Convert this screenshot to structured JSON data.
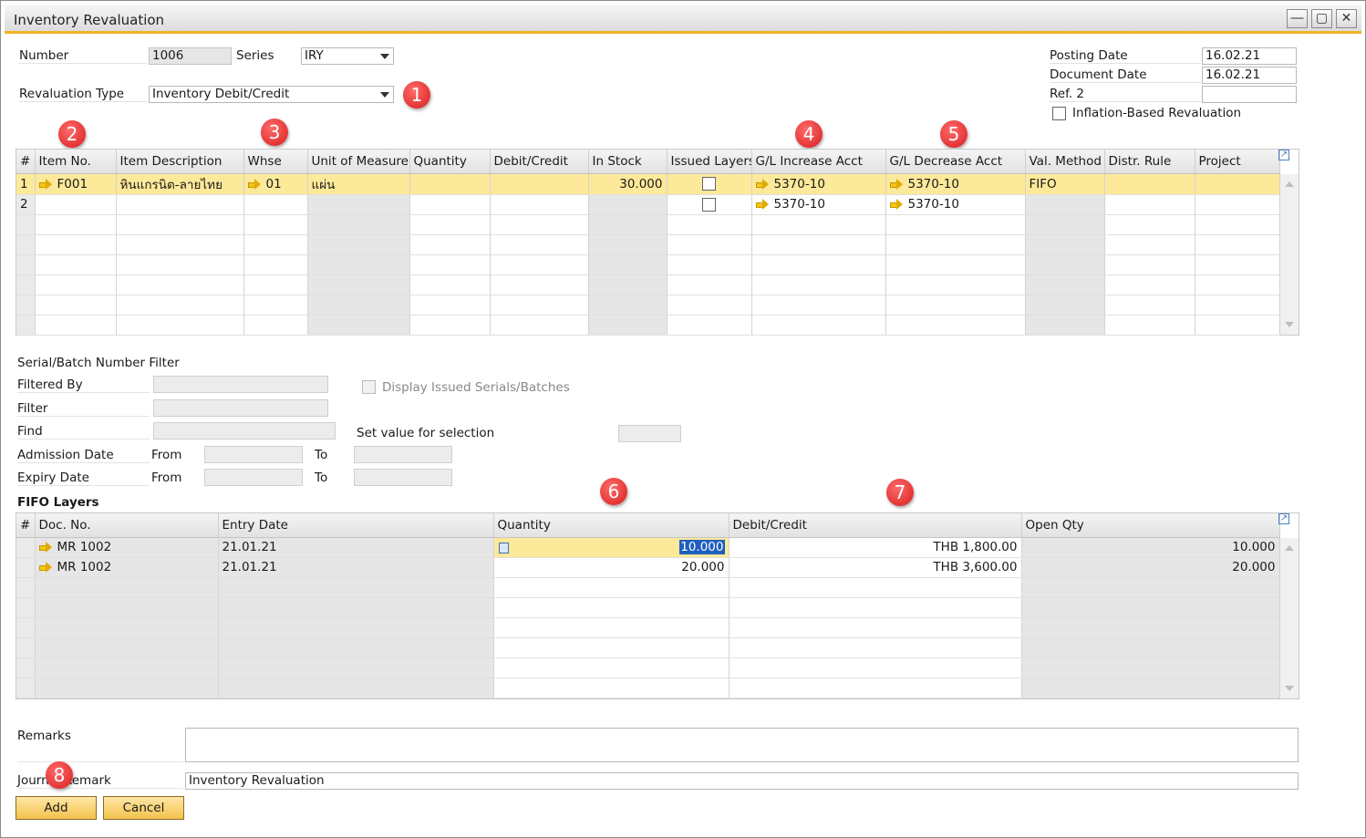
{
  "window": {
    "title": "Inventory Revaluation"
  },
  "header": {
    "number_label": "Number",
    "number_value": "1006",
    "series_label": "Series",
    "series_value": "IRY",
    "reval_type_label": "Revaluation Type",
    "reval_type_value": "Inventory Debit/Credit",
    "posting_date_label": "Posting Date",
    "posting_date_value": "16.02.21",
    "document_date_label": "Document Date",
    "document_date_value": "16.02.21",
    "ref2_label": "Ref. 2",
    "ref2_value": "",
    "inflation_label": "Inflation-Based Revaluation"
  },
  "badges": [
    "1",
    "2",
    "3",
    "4",
    "5",
    "6",
    "7",
    "8"
  ],
  "items_grid": {
    "columns": [
      "#",
      "Item No.",
      "Item Description",
      "Whse",
      "Unit of Measure",
      "Quantity",
      "Debit/Credit",
      "In Stock",
      "Issued Layers",
      "G/L Increase Acct",
      "G/L Decrease Acct",
      "Val. Method",
      "Distr. Rule",
      "Project"
    ],
    "rows": [
      {
        "num": "1",
        "item_no": "F001",
        "desc": "หินแกรนิต-ลายไทย",
        "whse": "01",
        "uom": "แผ่น",
        "qty": "",
        "debit": "",
        "in_stock": "30.000",
        "gl_inc": "5370-10",
        "gl_dec": "5370-10",
        "val_method": "FIFO",
        "distr": "",
        "project": ""
      },
      {
        "num": "2",
        "item_no": "",
        "desc": "",
        "whse": "",
        "uom": "",
        "qty": "",
        "debit": "",
        "in_stock": "",
        "gl_inc": "5370-10",
        "gl_dec": "5370-10",
        "val_method": "",
        "distr": "",
        "project": ""
      }
    ]
  },
  "filter": {
    "section_label": "Serial/Batch Number Filter",
    "filtered_by_label": "Filtered By",
    "filter_label": "Filter",
    "find_label": "Find",
    "admission_label": "Admission Date",
    "expiry_label": "Expiry Date",
    "from_label": "From",
    "to_label": "To",
    "display_issued_label": "Display Issued Serials/Batches",
    "set_value_label": "Set value for selection"
  },
  "fifo": {
    "section_label": "FIFO Layers",
    "columns": [
      "#",
      "Doc. No.",
      "Entry Date",
      "Quantity",
      "Debit/Credit",
      "Open Qty"
    ],
    "rows": [
      {
        "doc": "MR 1002",
        "date": "21.01.21",
        "qty": "10.000",
        "debit": "THB 1,800.00",
        "open": "10.000"
      },
      {
        "doc": "MR 1002",
        "date": "21.01.21",
        "qty": "20.000",
        "debit": "THB 3,600.00",
        "open": "20.000"
      }
    ]
  },
  "footer": {
    "remarks_label": "Remarks",
    "remarks_value": "",
    "journal_label": "Journal Remark",
    "journal_value": "Inventory Revaluation",
    "add_label": "Add",
    "cancel_label": "Cancel"
  }
}
